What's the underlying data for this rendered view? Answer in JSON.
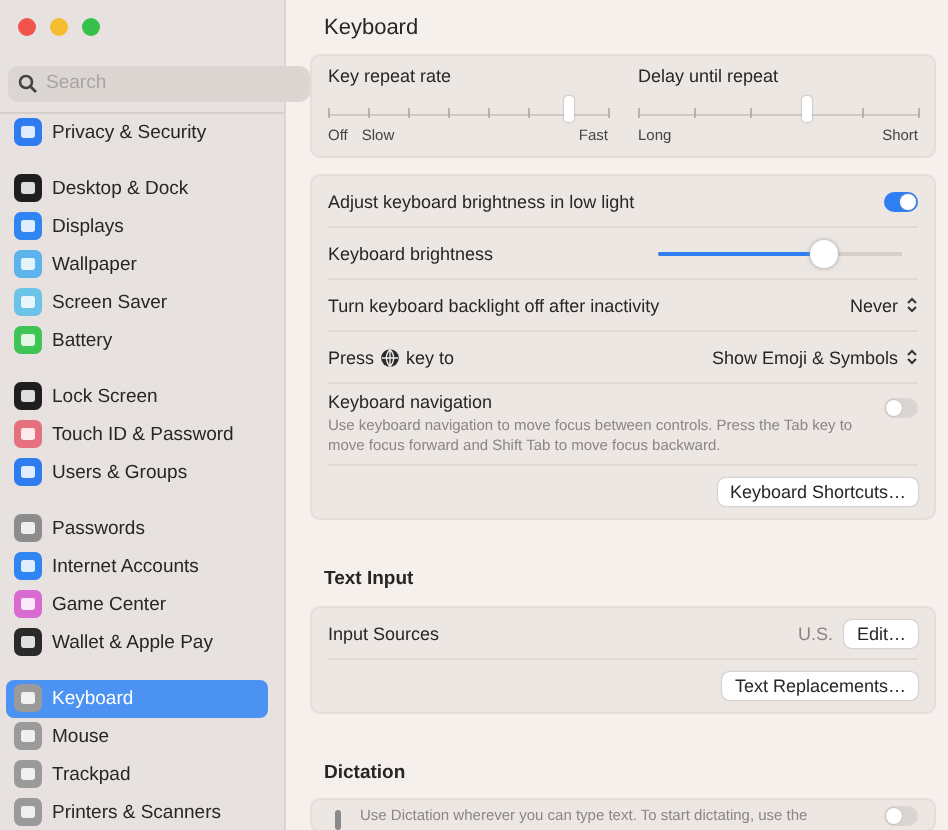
{
  "sidebar": {
    "search": {
      "placeholder": "Search"
    },
    "groups": [
      [
        {
          "label": "Privacy & Security",
          "color": "#2f7bf0",
          "selected": false
        }
      ],
      [
        {
          "label": "Desktop & Dock",
          "color": "#1e1e1e",
          "selected": false
        },
        {
          "label": "Displays",
          "color": "#2f86f2",
          "selected": false
        },
        {
          "label": "Wallpaper",
          "color": "#5bb4ec",
          "selected": false
        },
        {
          "label": "Screen Saver",
          "color": "#6cc3e8",
          "selected": false
        },
        {
          "label": "Battery",
          "color": "#3fc456",
          "selected": false
        }
      ],
      [
        {
          "label": "Lock Screen",
          "color": "#1e1e1e",
          "selected": false
        },
        {
          "label": "Touch ID & Password",
          "color": "#e7707f",
          "selected": false
        },
        {
          "label": "Users & Groups",
          "color": "#2f7bf0",
          "selected": false
        }
      ],
      [
        {
          "label": "Passwords",
          "color": "#8c8c8c",
          "selected": false
        },
        {
          "label": "Internet Accounts",
          "color": "#2f86f2",
          "selected": false
        },
        {
          "label": "Game Center",
          "color": "#d96ad0",
          "selected": false
        },
        {
          "label": "Wallet & Apple Pay",
          "color": "#2a2a2a",
          "selected": false
        }
      ],
      [
        {
          "label": "Keyboard",
          "color": "#9a9a9a",
          "selected": true
        },
        {
          "label": "Mouse",
          "color": "#9a9a9a",
          "selected": false
        },
        {
          "label": "Trackpad",
          "color": "#9a9a9a",
          "selected": false
        },
        {
          "label": "Printers & Scanners",
          "color": "#9a9a9a",
          "selected": false
        }
      ]
    ]
  },
  "title": "Keyboard",
  "repeat_sliders": [
    {
      "label": "Key repeat rate",
      "level": 0.857,
      "marks": [
        "Off",
        "Slow",
        "Fast"
      ]
    },
    {
      "label": "Delay until repeat",
      "level": 0.6,
      "marks": [
        "Long",
        "Short"
      ]
    }
  ],
  "settings": [
    {
      "kind": "toggle",
      "label": "Adjust keyboard brightness in low light",
      "on": true
    },
    {
      "kind": "slider",
      "label": "Keyboard brightness",
      "level": 0.68
    },
    {
      "kind": "popup",
      "label": "Turn keyboard backlight off after inactivity",
      "value": "Never"
    },
    {
      "kind": "globe",
      "label": "Press",
      "label_after": "key to",
      "value": "Show Emoji & Symbols"
    },
    {
      "kind": "toggle",
      "label": "Keyboard navigation",
      "description": "Use keyboard navigation to move focus between controls. Press the Tab key to move focus forward and Shift Tab to move focus backward.",
      "on": false
    },
    {
      "kind": "button",
      "label": "Keyboard Shortcuts…"
    }
  ],
  "text_input": {
    "heading": "Text Input",
    "source_label": "Input Sources",
    "source_value": "U.S.",
    "edit_button": "Edit…",
    "replacements_button": "Text Replacements…"
  },
  "dictation": {
    "heading": "Dictation",
    "description": "Use Dictation wherever you can type text. To start dictating, use the",
    "on": false
  }
}
